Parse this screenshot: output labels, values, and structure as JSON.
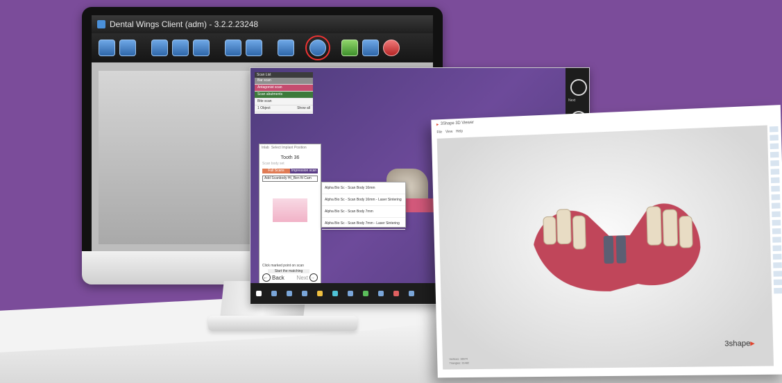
{
  "monitor1": {
    "title": "Dental Wings Client (adm) - 3.2.2.23248",
    "toolbar_icons": [
      "edit-icon",
      "patient-icon",
      "scan-icon",
      "monitor-icon",
      "camera-icon",
      "display-icon",
      "image-icon",
      "photo-icon",
      "link-icon",
      "sync-icon",
      "globe-icon",
      "power-icon"
    ]
  },
  "monitor2": {
    "side_panel": {
      "header": "Scan List",
      "rows": [
        "Bar scan",
        "Antagonist scan",
        "Scan abutments",
        "Bite scan"
      ],
      "footer_left": "1 Object",
      "footer_right": "Show all"
    },
    "dialog": {
      "header_left": "Inlab",
      "header_right": "Select Implant Position",
      "title": "Tooth 36",
      "subtitle": "Scan body set",
      "tab_active": "Full Scans",
      "tab_inactive": "Impression scan",
      "select_label": "Add Scanbody",
      "select_value": "Ht_Ben fit Cam",
      "instruction": "Click marked point on scan",
      "action_button": "Start the matching",
      "back_label": "Back",
      "next_label": "Next"
    },
    "dropdown_items": [
      "Alpha Bio Sc - Scan Body 16mm",
      "Alpha Bio Sc - Scan Body 16mm - Laser Sintering",
      "Alpha Bio Sc - Scan Body 7mm",
      "Alpha Bio Sc - Scan Body 7mm - Laser Sintering"
    ],
    "right_bar_label": "Next"
  },
  "monitor3": {
    "app_title": "3Shape 3D Viewer",
    "menu": [
      "File",
      "View",
      "Help"
    ],
    "brand_prefix": "3shape",
    "view_info_line1": "Vertices: 16674",
    "view_info_line2": "Triangles: 31482"
  },
  "colors": {
    "background": "#7b4c9a",
    "accent_brand": "#e0442e",
    "dialog_tab_active": "#e07b54",
    "dialog_tab": "#5a3c86"
  }
}
